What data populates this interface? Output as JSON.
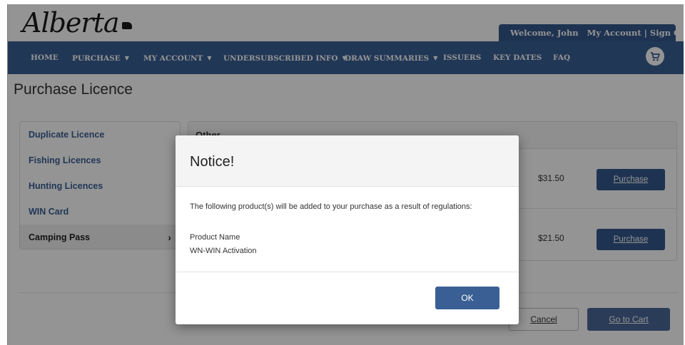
{
  "header": {
    "logo_text": "Alberta",
    "welcome": "Welcome, John",
    "my_account": "My Account",
    "separator": "|",
    "sign_out": "Sign Out"
  },
  "nav": {
    "items": [
      {
        "label": "HOME",
        "dropdown": false
      },
      {
        "label": "PURCHASE",
        "dropdown": true
      },
      {
        "label": "MY ACCOUNT",
        "dropdown": true
      },
      {
        "label": "UNDERSUBSCRIBED INFO",
        "dropdown": true
      },
      {
        "label": "DRAW SUMMARIES",
        "dropdown": true
      },
      {
        "label": "ISSUERS",
        "dropdown": false
      },
      {
        "label": "KEY DATES",
        "dropdown": false
      },
      {
        "label": "FAQ",
        "dropdown": false
      }
    ],
    "caret": "▼",
    "cart_icon": "shopping-cart-icon"
  },
  "page": {
    "title": "Purchase Licence"
  },
  "sidebar": {
    "items": [
      {
        "label": "Duplicate Licence",
        "active": false
      },
      {
        "label": "Fishing Licences",
        "active": false
      },
      {
        "label": "Hunting Licences",
        "active": false
      },
      {
        "label": "WIN Card",
        "active": false
      },
      {
        "label": "Camping Pass",
        "active": true
      }
    ],
    "chevron": "›"
  },
  "panel": {
    "heading": "Other",
    "rows": [
      {
        "price": "$31.50",
        "button": "Purchase"
      },
      {
        "price": "$21.50",
        "button": "Purchase"
      }
    ]
  },
  "footer": {
    "cancel": "Cancel",
    "go_to_cart": "Go to Cart"
  },
  "modal": {
    "title": "Notice!",
    "message": "The following product(s) will be added to your purchase as a result of regulations:",
    "column_header": "Product Name",
    "product": "WN-WIN Activation",
    "ok": "OK"
  },
  "colors": {
    "nav_blue": "#3a5f94",
    "button_blue": "#35588c",
    "link_blue": "#3a5f94"
  }
}
